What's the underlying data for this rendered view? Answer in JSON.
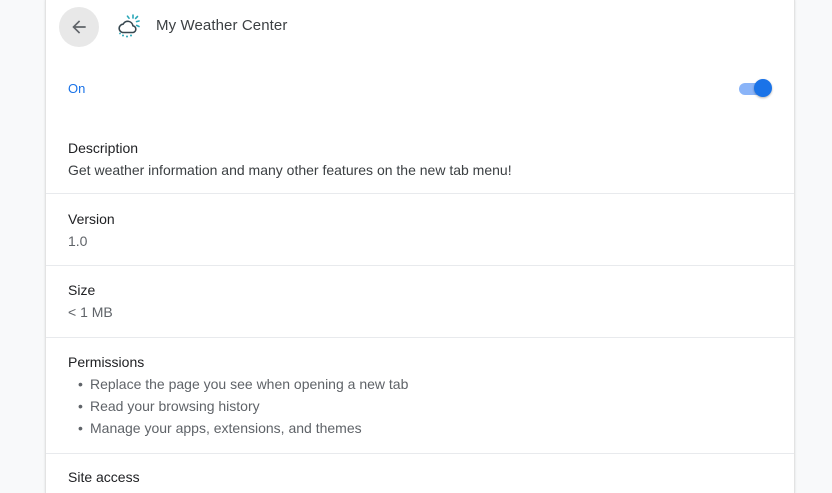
{
  "header": {
    "title": "My Weather Center",
    "back_icon": "arrow-back-icon",
    "extension_icon": "weather-cloud-sun-icon"
  },
  "enabled": {
    "label": "On",
    "state": true,
    "accent_color": "#1a73e8"
  },
  "description": {
    "label": "Description",
    "value": "Get weather information and many other features on the new tab menu!"
  },
  "version": {
    "label": "Version",
    "value": "1.0"
  },
  "size": {
    "label": "Size",
    "value": "< 1 MB"
  },
  "permissions": {
    "label": "Permissions",
    "items": [
      "Replace the page you see when opening a new tab",
      "Read your browsing history",
      "Manage your apps, extensions, and themes"
    ]
  },
  "site_access": {
    "label": "Site access"
  }
}
